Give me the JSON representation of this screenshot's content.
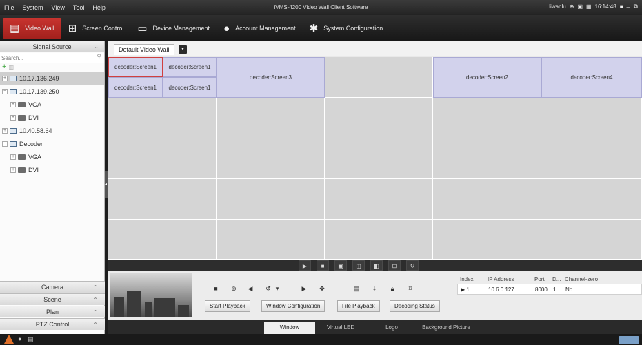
{
  "menu": {
    "items": [
      "File",
      "System",
      "View",
      "Tool",
      "Help"
    ]
  },
  "app_title": "iVMS-4200 Video Wall Client Software",
  "titlebar": {
    "user": "liwanlu",
    "time": "16:14:48",
    "minimize": "–",
    "restore": "⧉"
  },
  "modules": [
    {
      "label": "Video Wall",
      "active": true
    },
    {
      "label": "Screen Control"
    },
    {
      "label": "Device Management"
    },
    {
      "label": "Account Management"
    },
    {
      "label": "System Configuration"
    }
  ],
  "signal_source": {
    "title": "Signal Source",
    "search_placeholder": "Search...",
    "tree": [
      {
        "label": "10.17.136.249",
        "level": 0,
        "type": "monitor",
        "selected": true
      },
      {
        "label": "10.17.139.250",
        "level": 0,
        "type": "monitor"
      },
      {
        "label": "VGA",
        "level": 1,
        "type": "folder"
      },
      {
        "label": "DVI",
        "level": 1,
        "type": "folder"
      },
      {
        "label": "10.40.58.64",
        "level": 0,
        "type": "monitor"
      },
      {
        "label": "Decoder",
        "level": 0,
        "type": "monitor"
      },
      {
        "label": "VGA",
        "level": 1,
        "type": "folder"
      },
      {
        "label": "DVI",
        "level": 1,
        "type": "folder"
      }
    ]
  },
  "accordions": [
    "Camera",
    "Scene",
    "Plan",
    "PTZ Control"
  ],
  "wall": {
    "tab": "Default Video Wall",
    "screens": {
      "s1a": "decoder:Screen1",
      "s1b": "decoder:Screen1",
      "s1c": "decoder:Screen1",
      "s1d": "decoder:Screen1",
      "s3": "decoder:Screen3",
      "s2": "decoder:Screen2",
      "s4": "decoder:Screen4"
    }
  },
  "buttons": {
    "start_playback": "Start Playback",
    "window_configuration": "Window Configuration",
    "file_playback": "File Playback",
    "decoding_status": "Decoding Status"
  },
  "decoder_table": {
    "headers": [
      "Index",
      "IP Address",
      "Port",
      "D...",
      "Channel-zero"
    ],
    "rows": [
      {
        "index": "1",
        "ip": "10.6.0.127",
        "port": "8000",
        "d": "1",
        "channel_zero": "No"
      }
    ]
  },
  "bottom_tabs": [
    "Window",
    "Virtual LED",
    "Logo",
    "Background Picture"
  ]
}
